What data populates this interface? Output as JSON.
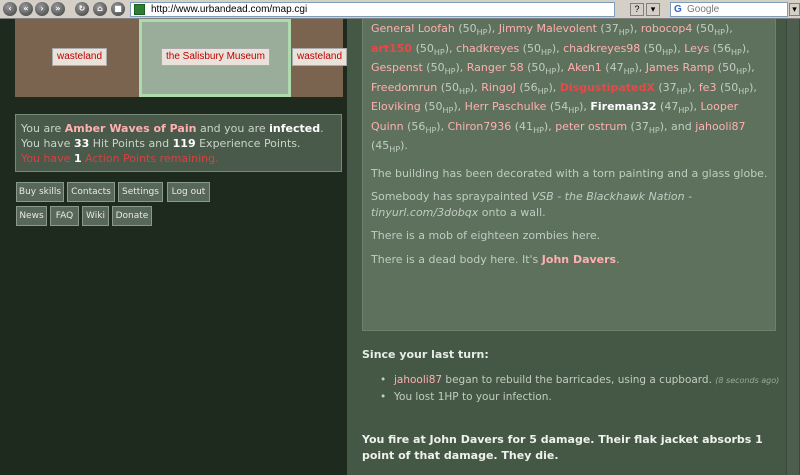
{
  "browser": {
    "url": "http://www.urbandead.com/map.cgi",
    "help_label": "?",
    "search_placeholder": "Google",
    "search_engine_glyph": "G"
  },
  "map": {
    "west": "wasteland",
    "center": "the Salisbury Museum",
    "east": "wasteland"
  },
  "status": {
    "prefix1": "You are ",
    "character": "Amber Waves of Pain",
    "mid1": " and you are ",
    "state": "infected",
    "end1": ".",
    "prefix2": "You have ",
    "hp": "33",
    "mid2": " Hit Points and ",
    "xp": "119",
    "end2": " Experience Points.",
    "prefix3": "You have ",
    "ap": "1",
    "end3": " Action Points remaining."
  },
  "buttons": {
    "buy_skills": "Buy skills",
    "contacts": "Contacts",
    "settings": "Settings",
    "log_out": "Log out",
    "news": "News",
    "faq": "FAQ",
    "wiki": "Wiki",
    "donate": "Donate"
  },
  "description": {
    "hp_unit": "HP",
    "survivors": [
      {
        "name": "General Loofah",
        "hp": "50"
      },
      {
        "name": "Jimmy Malevolent",
        "hp": "37"
      },
      {
        "name": "robocop4",
        "hp": "50"
      },
      {
        "name": "art150",
        "hp": "50"
      },
      {
        "name": "chadkreyes",
        "hp": "50"
      },
      {
        "name": "chadkreyes98",
        "hp": "50"
      },
      {
        "name": "Leys",
        "hp": "56"
      },
      {
        "name": "Gespenst",
        "hp": "50"
      },
      {
        "name": "Ranger 58",
        "hp": "50"
      },
      {
        "name": "Aken1",
        "hp": "47"
      },
      {
        "name": "James Ramp",
        "hp": "50"
      },
      {
        "name": "Freedomrun",
        "hp": "50"
      },
      {
        "name": "RingoJ",
        "hp": "56"
      },
      {
        "name": "DisgustipatedX",
        "hp": "37"
      },
      {
        "name": "fe3",
        "hp": "50"
      },
      {
        "name": "Eloviking",
        "hp": "50"
      },
      {
        "name": "Herr Paschulke",
        "hp": "54"
      },
      {
        "name": "Fireman32",
        "hp": "47"
      },
      {
        "name": "Looper Quinn",
        "hp": "56"
      },
      {
        "name": "Chiron7936",
        "hp": "41"
      },
      {
        "name": "peter ostrum",
        "hp": "37"
      },
      {
        "name": "jahooli87",
        "hp": "45"
      }
    ],
    "and_word": "and",
    "decor": "The building has been decorated with a torn painting and a glass globe.",
    "graffiti_prefix": "Somebody has spraypainted ",
    "graffiti": "VSB - the Blackhawk Nation - tinyurl.com/3dobqx",
    "graffiti_suffix": " onto a wall.",
    "mob": "There is a mob of eighteen zombies here.",
    "body_prefix": "There is a dead body here. It's ",
    "body_name": "John Davers",
    "body_suffix": "."
  },
  "events": {
    "heading": "Since your last turn:",
    "item1_name": "jahooli87",
    "item1_text": " began to rebuild the barricades, using a cupboard. ",
    "item1_time": "(8 seconds ago)",
    "item2": "You lost 1HP to your infection."
  },
  "result": "You fire at John Davers for 5 damage. Their flak jacket absorbs 1 point of that damage. They die.",
  "colors": {
    "panel_bg": "#1f2a1f",
    "description_bg": "#5d715d",
    "survivor_name": "#ffb0b0",
    "alert_red": "#d84040"
  }
}
